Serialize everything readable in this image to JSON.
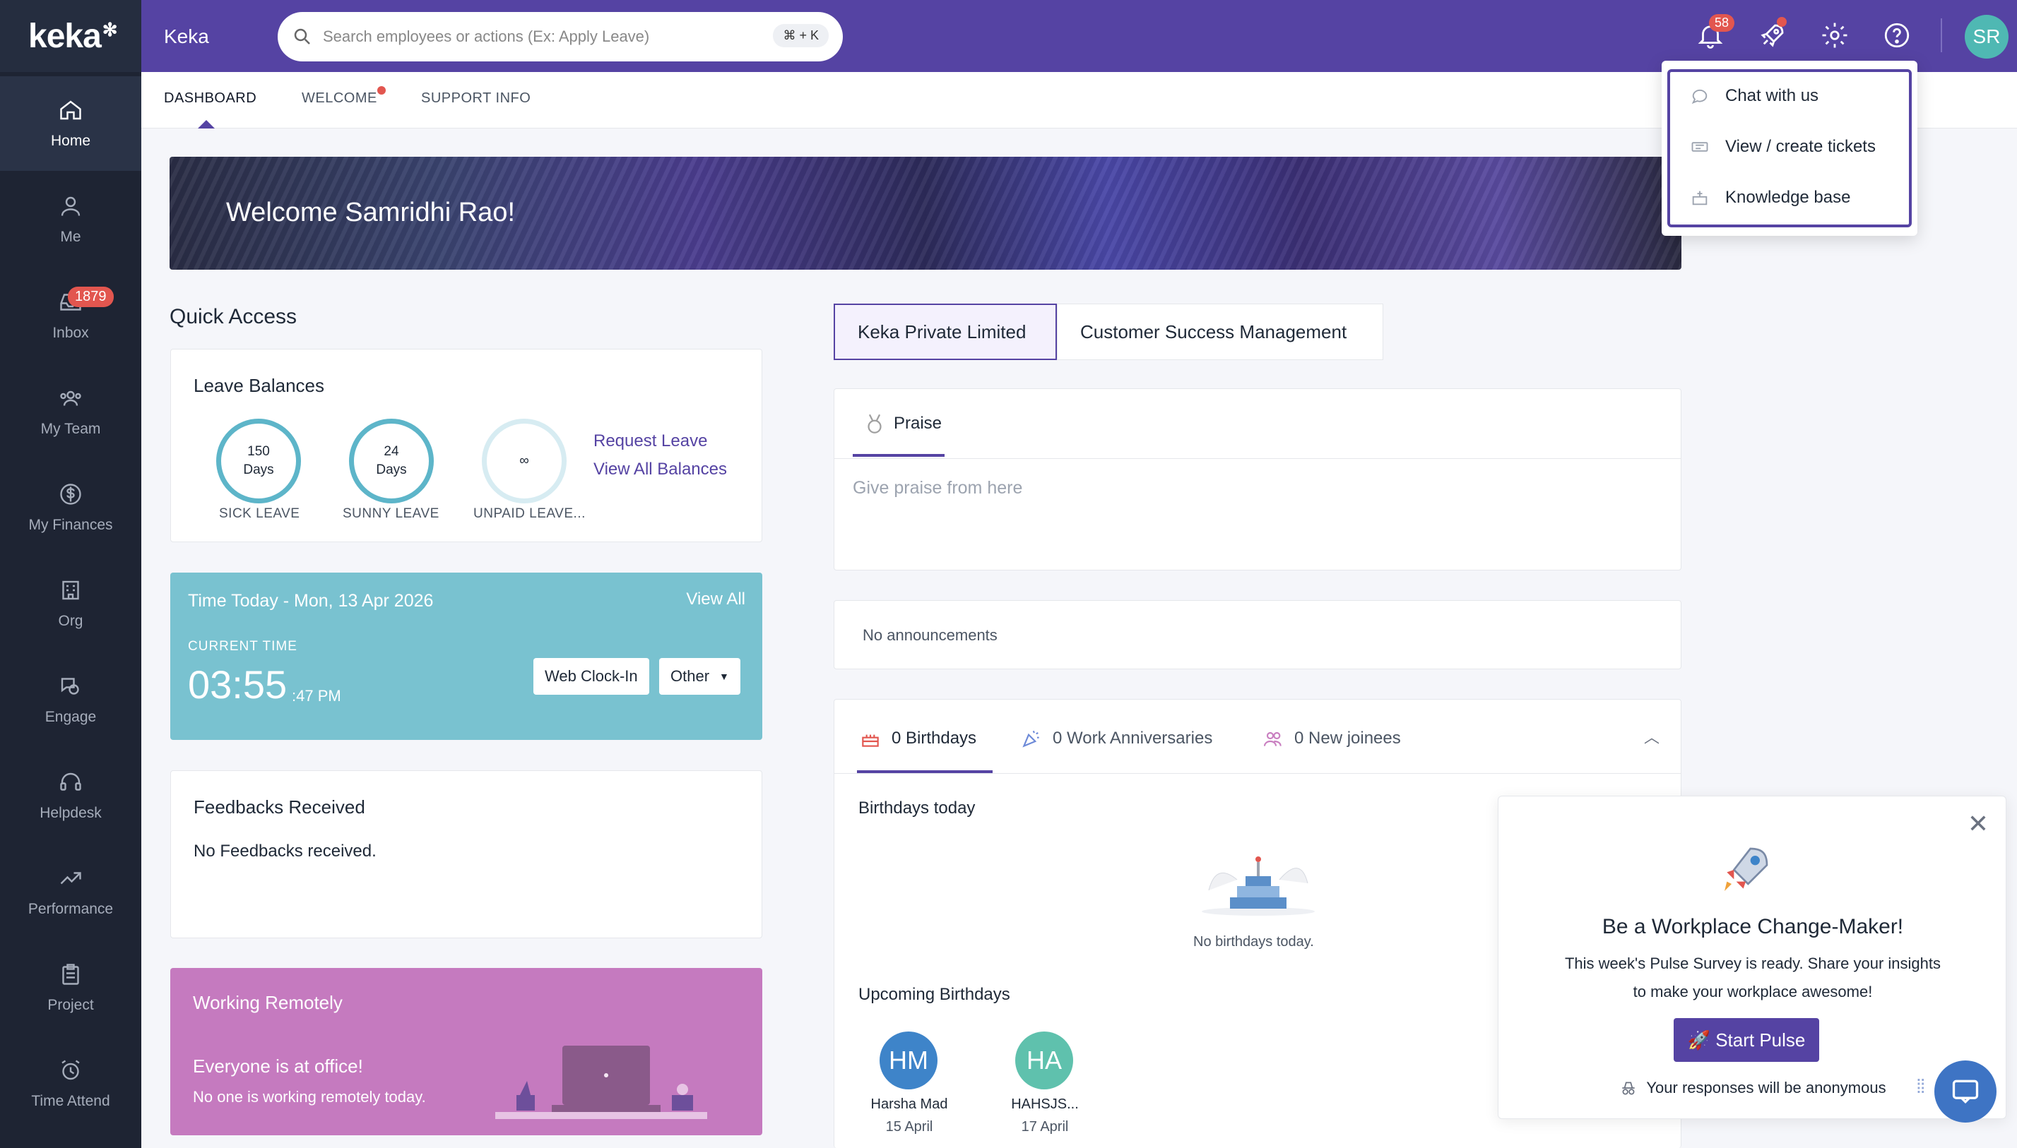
{
  "app": {
    "logo": "keka",
    "org_name": "Keka"
  },
  "search": {
    "placeholder": "Search employees or actions (Ex: Apply Leave)",
    "shortcut": "⌘ + K"
  },
  "topbar": {
    "notifications_count": "58",
    "avatar_initials": "SR",
    "accent": "#5543a3"
  },
  "sidebar": {
    "items": [
      {
        "label": "Home",
        "icon": "home-icon",
        "active": true
      },
      {
        "label": "Me",
        "icon": "user-icon"
      },
      {
        "label": "Inbox",
        "icon": "inbox-icon",
        "badge": "1879"
      },
      {
        "label": "My Team",
        "icon": "team-icon"
      },
      {
        "label": "My Finances",
        "icon": "dollar-icon"
      },
      {
        "label": "Org",
        "icon": "building-icon"
      },
      {
        "label": "Engage",
        "icon": "engage-icon"
      },
      {
        "label": "Helpdesk",
        "icon": "headset-icon"
      },
      {
        "label": "Performance",
        "icon": "trend-icon"
      },
      {
        "label": "Project",
        "icon": "clipboard-icon"
      },
      {
        "label": "Time Attend",
        "icon": "alarm-icon"
      }
    ]
  },
  "subtabs": [
    "DASHBOARD",
    "WELCOME",
    "SUPPORT INFO"
  ],
  "banner": {
    "title": "Welcome Samridhi Rao!"
  },
  "quick_access": {
    "title": "Quick Access",
    "leave": {
      "title": "Leave Balances",
      "items": [
        {
          "value": "150",
          "unit": "Days",
          "label": "SICK LEAVE"
        },
        {
          "value": "24",
          "unit": "Days",
          "label": "SUNNY LEAVE"
        },
        {
          "value": "∞",
          "unit": "",
          "label": "UNPAID LEAVE..."
        }
      ],
      "request_link": "Request Leave",
      "view_all_link": "View All Balances"
    },
    "time": {
      "title": "Time Today - Mon, 13 Apr 2026",
      "view_all": "View All",
      "current_label": "CURRENT TIME",
      "time": "03:55",
      "seconds": ":47 PM",
      "clock_in": "Web Clock-In",
      "other": "Other"
    },
    "feedback": {
      "title": "Feedbacks Received",
      "empty": "No Feedbacks received."
    },
    "remote": {
      "title": "Working Remotely",
      "headline": "Everyone is at office!",
      "sub": "No one is working remotely today."
    }
  },
  "org_tabs": [
    "Keka Private Limited",
    "Customer Success Management"
  ],
  "praise": {
    "tab": "Praise",
    "placeholder": "Give praise from here"
  },
  "announcements": {
    "empty": "No announcements"
  },
  "celebrations": {
    "tabs": [
      "0 Birthdays",
      "0 Work Anniversaries",
      "0 New joinees"
    ],
    "today_title": "Birthdays today",
    "today_empty": "No birthdays today.",
    "upcoming_title": "Upcoming Birthdays",
    "upcoming": [
      {
        "initials": "HM",
        "name": "Harsha Mad",
        "date": "15 April",
        "color": "#3e84c9"
      },
      {
        "initials": "HA",
        "name": "HAHSJS...",
        "date": "17 April",
        "color": "#5fc1ad"
      }
    ]
  },
  "help_menu": {
    "items": [
      {
        "label": "Chat with us",
        "icon": "chat-icon"
      },
      {
        "label": "View / create tickets",
        "icon": "ticket-icon"
      },
      {
        "label": "Knowledge base",
        "icon": "book-icon"
      }
    ]
  },
  "pulse": {
    "title": "Be a Workplace Change-Maker!",
    "body1": "This week's Pulse Survey is ready. Share your insights",
    "body2": "to make your workplace awesome!",
    "button": "🚀 Start Pulse",
    "footer": "Your responses will be anonymous"
  }
}
